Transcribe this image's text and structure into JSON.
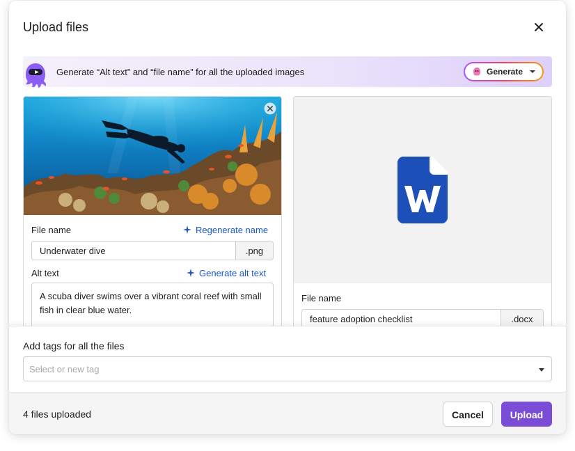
{
  "dialog": {
    "title": "Upload files"
  },
  "banner": {
    "text": "Generate “Alt text” and “file name” for all the uploaded images",
    "generate_label": "Generate"
  },
  "image_card": {
    "file_name_label": "File name",
    "regenerate_label": "Regenerate name",
    "file_name_value": "Underwater dive",
    "extension": ".png",
    "alt_text_label": "Alt text",
    "generate_alt_label": "Generate alt text",
    "alt_text_value": "A scuba diver swims over a vibrant coral reef with small fish in clear blue water."
  },
  "doc_card": {
    "file_name_label": "File name",
    "file_name_value": "feature adoption checklist",
    "extension": ".docx"
  },
  "tags": {
    "label": "Add tags for all the files",
    "placeholder": "Select or new tag"
  },
  "footer": {
    "count_text": "4 files uploaded",
    "cancel_label": "Cancel",
    "upload_label": "Upload"
  },
  "colors": {
    "accent": "#7b4dd6",
    "link": "#1a56c4",
    "word_blue": "#1d4fb8"
  },
  "icons": [
    "close-icon",
    "octopus-mascot-icon",
    "sparkle-icon",
    "remove-image-icon",
    "word-document-icon",
    "chevron-down-icon"
  ]
}
